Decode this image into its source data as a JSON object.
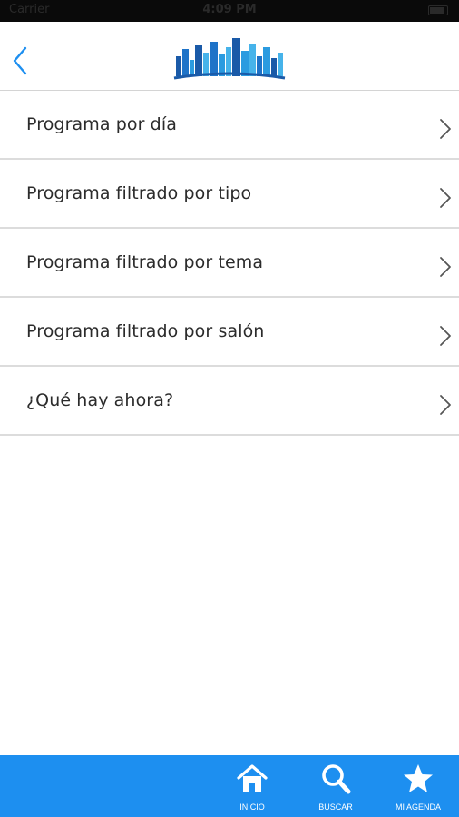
{
  "status_bar": {
    "carrier": "Carrier",
    "time": "4:09 PM"
  },
  "nav": {
    "back_icon": "chevron-left-icon",
    "logo_icon": "city-skyline-logo"
  },
  "menu": {
    "items": [
      {
        "label": "Programa por día"
      },
      {
        "label": "Programa filtrado por tipo"
      },
      {
        "label": "Programa filtrado por tema"
      },
      {
        "label": "Programa filtrado por salón"
      },
      {
        "label": "¿Qué hay ahora?"
      }
    ]
  },
  "tab_bar": {
    "tabs": [
      {
        "label": "INICIO",
        "icon": "home-icon"
      },
      {
        "label": "BUSCAR",
        "icon": "search-icon"
      },
      {
        "label": "MI AGENDA",
        "icon": "star-icon"
      }
    ]
  },
  "colors": {
    "accent": "#1d8ff0",
    "text": "#2b2b2b",
    "divider": "#dcdcdc"
  }
}
